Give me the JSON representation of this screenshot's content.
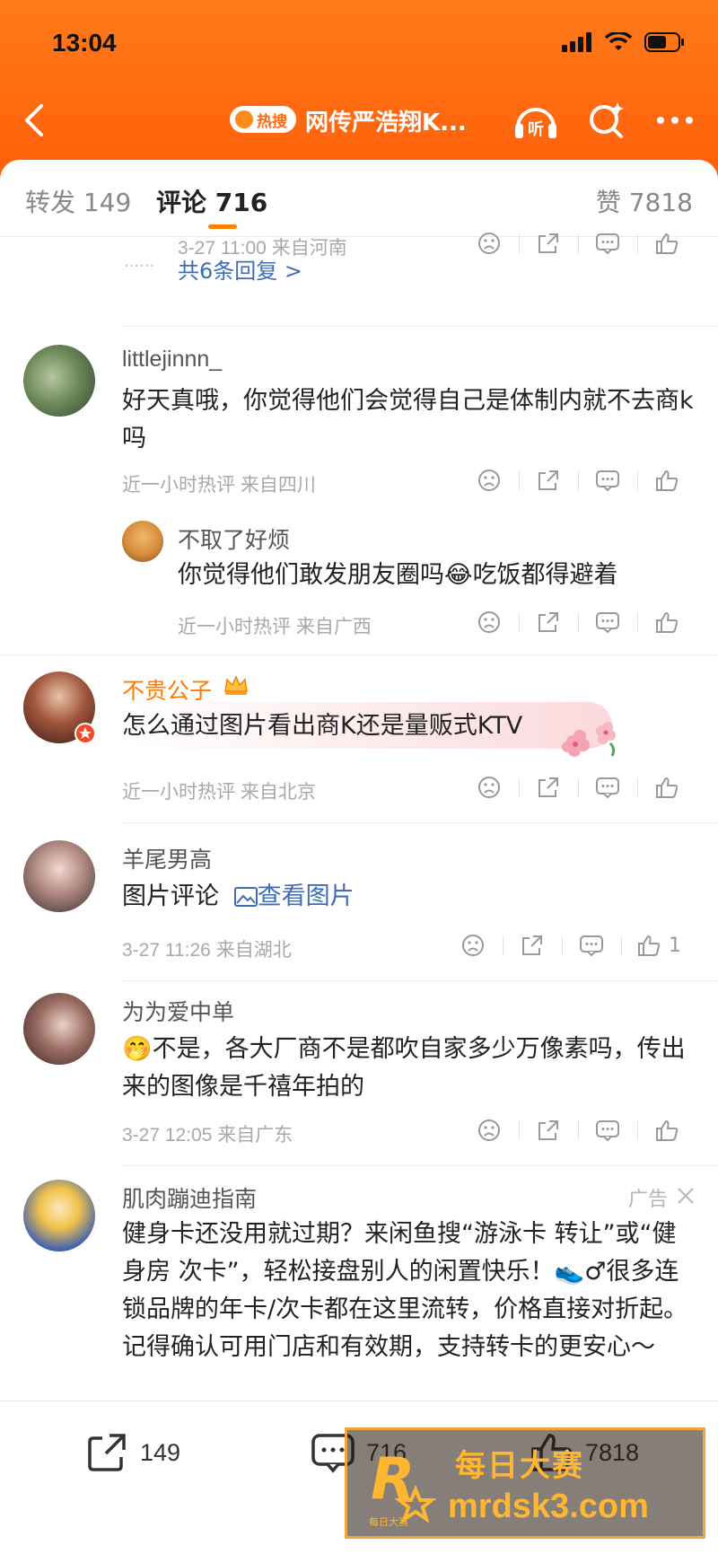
{
  "status_bar": {
    "time": "13:04"
  },
  "nav": {
    "hot_badge": "热搜",
    "title": "网传严浩翔K...",
    "listen_label": "听"
  },
  "tabs": {
    "repost": "转发 149",
    "comment": "评论 716",
    "like": "赞 7818"
  },
  "first_partial": {
    "meta": "3-27 11:00  来自河南",
    "more_replies": "共6条回复 >",
    "dots": "······"
  },
  "comments": [
    {
      "username": "littlejinnn_",
      "text": "好天真哦，你觉得他们会觉得自己是体制内就不去商k吗",
      "meta": "近一小时热评  来自四川",
      "reply": {
        "username": "不取了好烦",
        "text_before": "你觉得他们敢发朋友圈吗",
        "emoji": "😂",
        "text_after": "吃饭都得避着",
        "meta": "近一小时热评  来自广西"
      }
    },
    {
      "username": "不贵公子",
      "text": "怎么通过图片看出商K还是量贩式KTV",
      "meta": "近一小时热评  来自北京"
    },
    {
      "username": "羊尾男高",
      "text": "图片评论",
      "link": "查看图片",
      "meta": "3-27 11:26  来自湖北",
      "like_count": "1"
    },
    {
      "username": "为为爱中单",
      "emoji": "🤭",
      "text": "不是，各大厂商不是都吹自家多少万像素吗，传出来的图像是千禧年拍的",
      "meta": "3-27 12:05  来自广东"
    },
    {
      "username": "肌肉蹦迪指南",
      "ad_label": "广告",
      "text": "健身卡还没用就过期？来闲鱼搜“游泳卡 转让”或“健身房 次卡”，轻松接盘别人的闲置快乐！",
      "text_emoji": "👟♂",
      "text_2": "很多连锁品牌的年卡/次卡都在这里流转，价格直接对折起。记得确认可用门店和有效期，支持转卡的更安心～"
    }
  ],
  "bottom_bar": {
    "repost_count": "149",
    "comment_count": "716",
    "like_count": "7818"
  },
  "watermark": {
    "title": "每日大赛",
    "url": "mrdsk3.com",
    "logo_letter": "R",
    "logo_small": "每日大赛"
  },
  "colors": {
    "header_orange": "#ff6a10",
    "accent": "#ff8200",
    "link": "#3e6db5"
  }
}
